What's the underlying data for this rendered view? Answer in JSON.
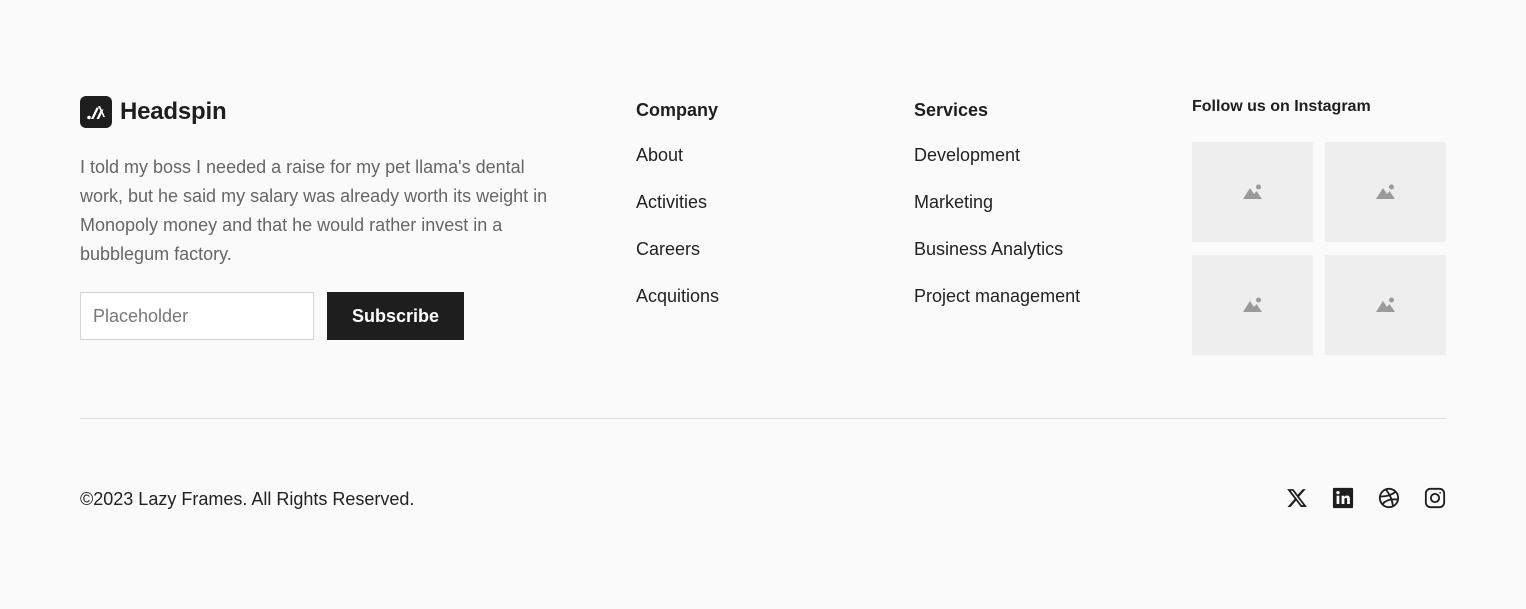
{
  "brand": {
    "name": "Headspin",
    "tagline": "I told my boss I needed a raise for my pet llama's dental work, but he said my salary was already worth its weight in Monopoly money and that he would rather invest in a bubblegum factory.",
    "logo_icon": "headspin-logo-icon"
  },
  "subscribe": {
    "input_value": "",
    "placeholder": "Placeholder",
    "button_label": "Subscribe"
  },
  "columns": [
    {
      "heading": "Company",
      "links": [
        "About",
        "Activities",
        "Careers",
        "Acquitions"
      ]
    },
    {
      "heading": "Services",
      "links": [
        "Development",
        "Marketing",
        "Business Analytics",
        "Project management"
      ]
    }
  ],
  "instagram": {
    "heading": "Follow us on Instagram",
    "tiles": [
      "image-placeholder-icon",
      "image-placeholder-icon",
      "image-placeholder-icon",
      "image-placeholder-icon"
    ]
  },
  "footer": {
    "copyright": "©2023 Lazy Frames. All Rights Reserved.",
    "socials": [
      "x-icon",
      "linkedin-icon",
      "dribbble-icon",
      "instagram-icon"
    ]
  },
  "colors": {
    "background": "#fafafa",
    "primary": "#1e1e1e",
    "muted_text": "#666666",
    "tile_bg": "#eeeeee",
    "divider": "#dcdcdc"
  }
}
